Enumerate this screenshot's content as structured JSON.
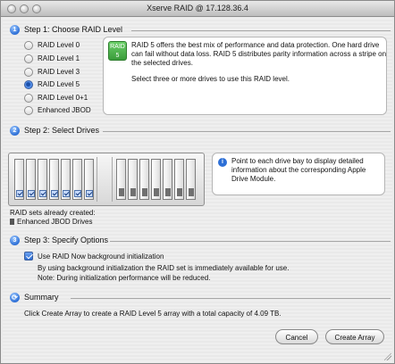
{
  "window": {
    "title": "Xserve RAID @ 17.128.36.4"
  },
  "step1": {
    "number": "1",
    "title": "Step 1: Choose RAID Level",
    "options": [
      {
        "label": "RAID Level 0",
        "selected": false
      },
      {
        "label": "RAID Level 1",
        "selected": false
      },
      {
        "label": "RAID Level 3",
        "selected": false
      },
      {
        "label": "RAID Level 5",
        "selected": true
      },
      {
        "label": "RAID Level 0+1",
        "selected": false
      },
      {
        "label": "Enhanced JBOD",
        "selected": false
      }
    ],
    "badge_line1": "RAID",
    "badge_line2": "5",
    "description": "RAID 5 offers the best mix of performance and data protection. One hard drive can fail without data loss. RAID 5 distributes parity information across a stripe on the selected drives.",
    "hint": "Select three or more drives to use this RAID level."
  },
  "step2": {
    "number": "2",
    "title": "Step 2: Select Drives",
    "info": "Point to each drive bay to display detailed information about the corresponding Apple Drive Module.",
    "sets_label": "RAID sets already created:",
    "sets_item": "Enhanced JBOD Drives",
    "selected_bays": 7,
    "total_bays": 14
  },
  "step3": {
    "number": "3",
    "title": "Step 3: Specify Options",
    "checkbox_label": "Use RAID Now background initialization",
    "checkbox_checked": true,
    "note1": "By using background initialization the RAID set is immediately available for use.",
    "note2": "Note: During initialization performance will be reduced."
  },
  "summary": {
    "title": "Summary",
    "text_prefix": "Click Create Array to create a RAID Level 5 array with a total capacity of",
    "capacity": "4.09 TB."
  },
  "buttons": {
    "cancel": "Cancel",
    "create": "Create Array"
  },
  "colors": {
    "accent": "#2d6fd6",
    "raid_badge": "#3a9c3a"
  },
  "icons": {
    "step_marker": "numbered-circle-icon",
    "info": "info-icon",
    "summary": "refresh-arrows-icon"
  }
}
